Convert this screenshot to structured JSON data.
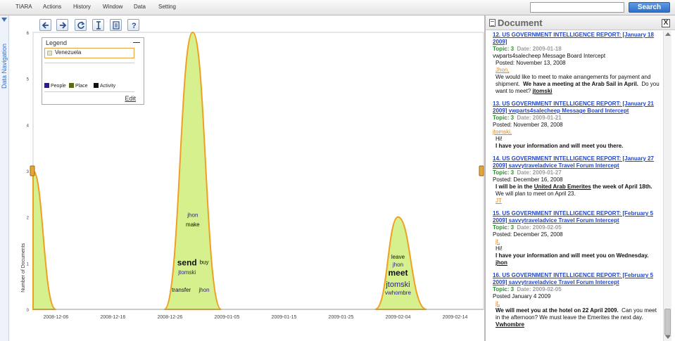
{
  "menu": {
    "items": [
      "TIARA",
      "Actions",
      "History",
      "Window",
      "Data",
      "Setting"
    ],
    "search_placeholder": "",
    "search_button": "Search"
  },
  "nav": {
    "label": "Data Navigation"
  },
  "toolbar": {
    "buttons": [
      "back-icon",
      "forward-icon",
      "refresh-icon",
      "text-cursor-icon",
      "document-icon",
      "help-icon"
    ]
  },
  "legend": {
    "title": "Legend",
    "collapse": "—",
    "item": "Venezuela",
    "keys": [
      {
        "label": "People",
        "color": "#2b1a8c"
      },
      {
        "label": "Place",
        "color": "#556b18"
      },
      {
        "label": "Activity",
        "color": "#111111"
      }
    ],
    "edit": "Edit"
  },
  "chart_data": {
    "type": "area",
    "ylabel": "Number of Documents",
    "ylim": [
      0,
      6
    ],
    "yticks": [
      0,
      1,
      2,
      3,
      4,
      5,
      6
    ],
    "xlim": [
      "2008-12-02",
      "2009-02-19"
    ],
    "xticks": [
      "2008-12-06",
      "2008-12-16",
      "2008-12-26",
      "2009-01-05",
      "2009-01-15",
      "2009-01-25",
      "2009-02-04",
      "2009-02-14"
    ],
    "fill": "#d6f08e",
    "stroke": "#f0a020",
    "peaks": [
      {
        "center": "2008-12-02",
        "value": 3,
        "start": "2008-12-02",
        "end": "2008-12-06"
      },
      {
        "center": "2008-12-30",
        "value": 6,
        "start": "2008-12-25",
        "end": "2009-01-04"
      },
      {
        "center": "2009-02-04",
        "value": 2,
        "start": "2009-01-31",
        "end": "2009-02-09"
      }
    ],
    "keywords": [
      {
        "text": "jhon",
        "type": "People",
        "date": "2008-12-30",
        "y": 2.0,
        "size": "small"
      },
      {
        "text": "make",
        "type": "Activity",
        "date": "2008-12-30",
        "y": 1.8,
        "size": "small"
      },
      {
        "text": "send",
        "type": "Activity",
        "date": "2008-12-29",
        "y": 0.95,
        "size": "large"
      },
      {
        "text": "buy",
        "type": "Activity",
        "date": "2009-01-01",
        "y": 0.98,
        "size": "small"
      },
      {
        "text": "jtomski",
        "type": "People",
        "date": "2008-12-29",
        "y": 0.76,
        "size": "small"
      },
      {
        "text": "transfer",
        "type": "Activity",
        "date": "2008-12-28",
        "y": 0.38,
        "size": "small"
      },
      {
        "text": "jhon",
        "type": "People",
        "date": "2009-01-01",
        "y": 0.38,
        "size": "small"
      },
      {
        "text": "leave",
        "type": "Activity",
        "date": "2009-02-04",
        "y": 1.1,
        "size": "small"
      },
      {
        "text": "jhon",
        "type": "People",
        "date": "2009-02-04",
        "y": 0.93,
        "size": "small"
      },
      {
        "text": "meet",
        "type": "Activity",
        "date": "2009-02-04",
        "y": 0.73,
        "size": "large"
      },
      {
        "text": "jtomski",
        "type": "People",
        "date": "2009-02-04",
        "y": 0.49,
        "size": "medium"
      },
      {
        "text": "vwhombre",
        "type": "People",
        "date": "2009-02-04",
        "y": 0.32,
        "size": "small"
      }
    ]
  },
  "document": {
    "title": "Document",
    "close": "X",
    "reports": [
      {
        "title": "12.     US GOVERNMENT INTELLIGENCE REPORT: [January 18 2009]",
        "topic": "Topic: 3",
        "date": "Date: 2009-01-18",
        "source": "vwparts4salecheep Message Board Intercept",
        "posted": "Posted:  November 13, 2008",
        "author": "Jhon,",
        "body_1": "We would like to meet to make arrangements for payment and shipment.",
        "body_bold": "We have a meeting at the Arab Sail in April.",
        "body_2": "Do you want to meet?",
        "signoff": "jtomski"
      },
      {
        "title": "13.     US GOVERNMENT INTELLIGENCE REPORT: [January 21 2009] vwparts4salecheep Message Board Intercept",
        "topic": "Topic: 3",
        "date": "Date: 2009-01-21",
        "posted": "Posted:  November 28, 2008",
        "author": "jtomski,",
        "line_1": "Hi!",
        "line_2": "I have your information and will meet you there."
      },
      {
        "title": "14.     US GOVERNMENT INTELLIGENCE REPORT: [January 27 2009] savvytraveladvice Travel Forum Intercept",
        "topic": "Topic: 3",
        "date": "Date: 2009-01-27",
        "posted": "Posted:  December 16, 2008",
        "line_1a": "I will be in the",
        "line_1b": "United Arab Emerites",
        "line_1c": "the week of April 18th.",
        "line_2": "We will plan to meet on April 23.",
        "signoff": "JT"
      },
      {
        "title": "15.     US GOVERNMENT INTELLIGENCE REPORT: [February 5 2009] savvytraveladvice Travel Forum Intercept",
        "topic": "Topic: 3",
        "date": "Date: 2009-02-05",
        "posted": "Posted:  December 25, 2008",
        "author": "jt,",
        "line_1": "Hi!",
        "line_2": "I have your information and will meet you on Wednesday.",
        "signoff": "jhon"
      },
      {
        "title": "16.     US GOVERNMENT INTELLIGENCE REPORT: [February 5 2009] savvytraveladvice Travel Forum Intercept",
        "topic": "Topic: 3",
        "date": "Date: 2009-02-05",
        "posted": "Posted January 4 2009",
        "author": "jt,",
        "body_bold": "We will meet you at the hotel on 22 April 2009.",
        "body_2": "Can you meet in the afternoon?  We must leave the Emerites the next day.",
        "signoff": "Vwhombre"
      }
    ]
  }
}
